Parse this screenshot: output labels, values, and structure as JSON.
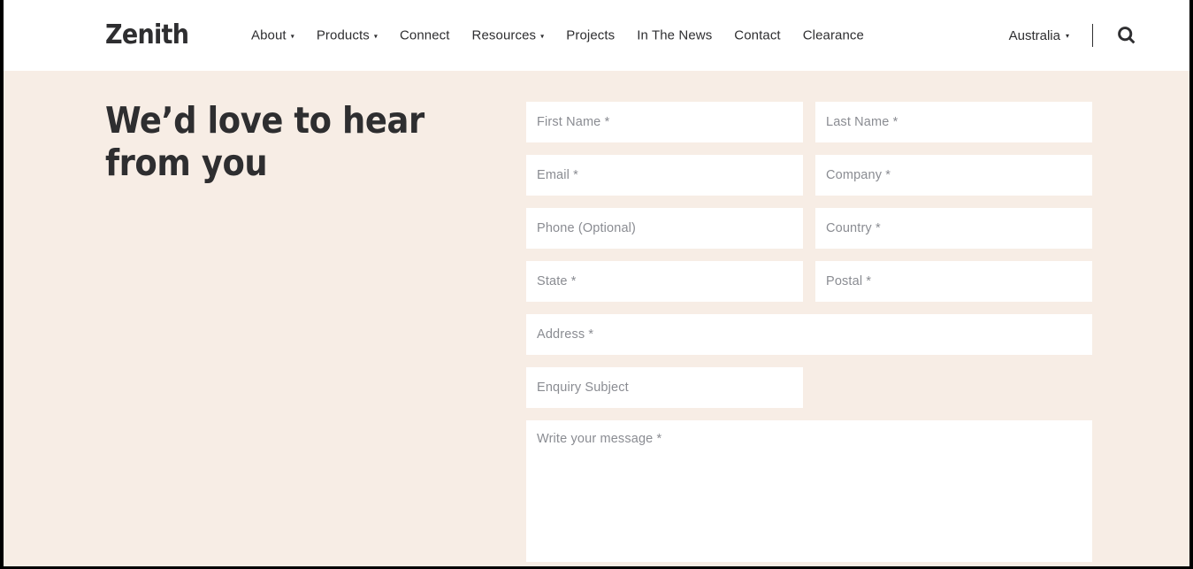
{
  "header": {
    "logo": "Zenith",
    "nav": [
      {
        "label": "About",
        "has_dropdown": true,
        "caret": "▾"
      },
      {
        "label": "Products",
        "has_dropdown": true,
        "caret": "▾"
      },
      {
        "label": "Connect",
        "has_dropdown": false,
        "caret": ""
      },
      {
        "label": "Resources",
        "has_dropdown": true,
        "caret": "▾"
      },
      {
        "label": "Projects",
        "has_dropdown": false,
        "caret": ""
      },
      {
        "label": "In The News",
        "has_dropdown": false,
        "caret": ""
      },
      {
        "label": "Contact",
        "has_dropdown": false,
        "caret": ""
      },
      {
        "label": "Clearance",
        "has_dropdown": false,
        "caret": ""
      }
    ],
    "region": {
      "label": "Australia",
      "caret": "▾"
    },
    "search_icon": "search-icon"
  },
  "main": {
    "title": "We’d love to hear from you"
  },
  "form": {
    "fields": {
      "first_name": {
        "placeholder": "First Name *",
        "value": ""
      },
      "last_name": {
        "placeholder": "Last Name *",
        "value": ""
      },
      "email": {
        "placeholder": "Email *",
        "value": ""
      },
      "company": {
        "placeholder": "Company *",
        "value": ""
      },
      "phone": {
        "placeholder": "Phone (Optional)",
        "value": ""
      },
      "country": {
        "placeholder": "Country *",
        "value": ""
      },
      "state": {
        "placeholder": "State *",
        "value": ""
      },
      "postal": {
        "placeholder": "Postal *",
        "value": ""
      },
      "address": {
        "placeholder": "Address *",
        "value": ""
      },
      "enquiry_subject": {
        "placeholder": "Enquiry Subject",
        "value": ""
      },
      "message": {
        "placeholder": "Write your message *",
        "value": ""
      }
    }
  },
  "colors": {
    "page_background": "#F7EDE5",
    "header_background": "#FFFFFF",
    "text_dark": "#2E2E30",
    "placeholder": "#8A8C92",
    "field_background": "#FFFFFF",
    "frame": "#000000"
  }
}
